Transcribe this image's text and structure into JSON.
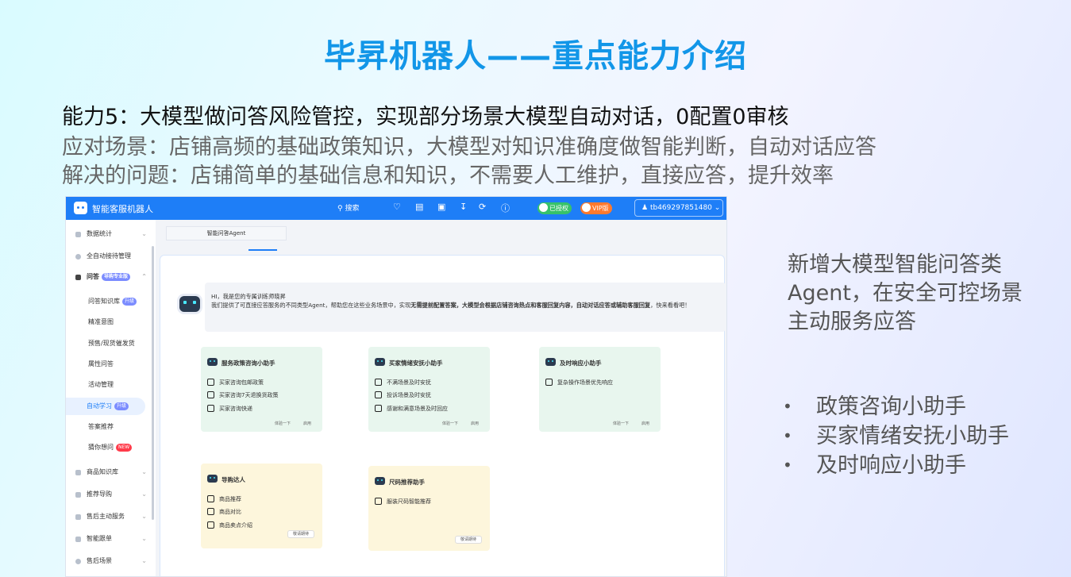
{
  "slide": {
    "title": "毕昇机器人——重点能力介绍",
    "capability": "能力5：大模型做问答风险管控，实现部分场景大模型自动对话，0配置0审核",
    "scenario": "应对场景：店铺高频的基础政策知识，大模型对知识准确度做智能判断，自动对话应答",
    "problem": "解决的问题：店铺简单的基础信息和知识，不需要人工维护，直接应答，提升效率",
    "side_description": "新增大模型智能问答类Agent，在安全可控场景主动服务应答",
    "bullets": [
      "政策咨询小助手",
      "买家情绪安抚小助手",
      "及时响应小助手"
    ]
  },
  "app": {
    "name": "智能客服机器人",
    "search_label": "搜索",
    "badge_authorized": "已授权",
    "badge_vip": "VIP版",
    "user": "tb469297851480",
    "header_icons": [
      "bell-icon",
      "document-icon",
      "screen-icon",
      "download-icon",
      "refresh-icon",
      "help-icon"
    ],
    "sidebar": {
      "stats": "数据统计",
      "auto_reception": "全自动接待管理",
      "qa": "问答",
      "qa_tag": "导购专业版",
      "qa_kb": "问答知识库",
      "qa_kb_tag": "升级",
      "precise_intent": "精准意图",
      "presale": "预售/现货催发货",
      "attr_qa": "属性问答",
      "activity": "活动管理",
      "auto_learn": "自动学习",
      "auto_learn_tag": "升级",
      "answer_recommend": "答案推荐",
      "guess": "猜你想问",
      "guess_tag": "NEW",
      "product_kb": "商品知识库",
      "recommend_guide": "推荐导购",
      "after_sale": "售后主动服务",
      "smart_follow": "智能跟单",
      "after_scene": "售后场景"
    },
    "tab": "智能问答Agent",
    "welcome": {
      "greeting": "HI，我是您的专属训练师晓昇",
      "intro_prefix": "我们提供了可直接应答服务的不同类型Agent，帮助您在这些业务场景中，实现",
      "intro_bold": "无需提前配置答案，大模型会根据店铺咨询热点和客服回复内容，自动对话应答或辅助客服回复",
      "intro_suffix": "，快来看看吧！"
    },
    "cards": [
      {
        "title": "服务政策咨询小助手",
        "options": [
          "买家咨询包邮政策",
          "买家咨询7天退换货政策",
          "买家咨询快递"
        ],
        "actions": [
          "体验一下",
          "启用"
        ]
      },
      {
        "title": "买家情绪安抚小助手",
        "options": [
          "不满场景及时安抚",
          "投诉场景及时安抚",
          "感谢和满意场景及时回应"
        ],
        "actions": [
          "体验一下",
          "启用"
        ]
      },
      {
        "title": "及时响应小助手",
        "options": [
          "复杂操作场景优先响应"
        ],
        "actions": [
          "体验一下",
          "启用"
        ]
      },
      {
        "title": "导购达人",
        "options": [
          "商品推荐",
          "商品对比",
          "商品卖点介绍"
        ],
        "button": "敬请期待"
      },
      {
        "title": "尺码推荐助手",
        "options": [
          "服装尺码智能推荐"
        ],
        "button": "敬请期待"
      }
    ]
  }
}
